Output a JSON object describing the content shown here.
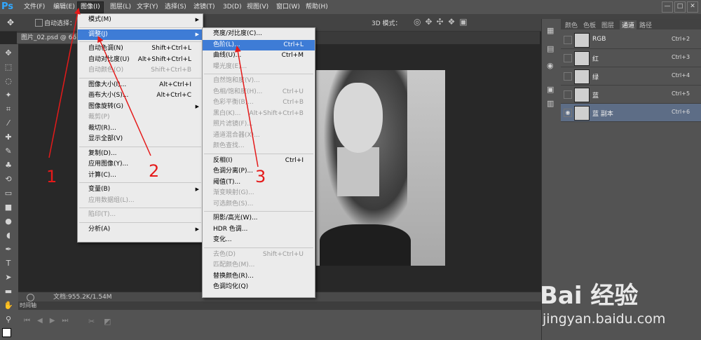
{
  "app": {
    "logo": "Ps"
  },
  "menubar": {
    "items": [
      "文件(F)",
      "编辑(E)",
      "图像(I)",
      "图层(L)",
      "文字(Y)",
      "选择(S)",
      "滤镜(T)",
      "3D(D)",
      "视图(V)",
      "窗口(W)",
      "帮助(H)"
    ],
    "active_index": 2
  },
  "window_buttons": [
    "—",
    "□",
    "✕"
  ],
  "optbar": {
    "auto_select_label": "自动选择：",
    "mode3d_label": "3D 模式："
  },
  "doc_tab": {
    "label": "图片_02.psd @ 66.7"
  },
  "status": {
    "doc_text": "文档:955.2K/1.54M"
  },
  "timeline": {
    "label": "时间轴"
  },
  "image_menu": {
    "items": [
      {
        "label": "模式(M)",
        "shortcut": "",
        "submenu": true,
        "disabled": false
      },
      {
        "sep": true
      },
      {
        "label": "调整(J)",
        "shortcut": "",
        "submenu": true,
        "disabled": false,
        "highlighted": true
      },
      {
        "sep": true
      },
      {
        "label": "自动色调(N)",
        "shortcut": "Shift+Ctrl+L",
        "disabled": false
      },
      {
        "label": "自动对比度(U)",
        "shortcut": "Alt+Shift+Ctrl+L",
        "disabled": false
      },
      {
        "label": "自动颜色(O)",
        "shortcut": "Shift+Ctrl+B",
        "disabled": true
      },
      {
        "sep": true
      },
      {
        "label": "图像大小(I)...",
        "shortcut": "Alt+Ctrl+I",
        "disabled": false
      },
      {
        "label": "画布大小(S)...",
        "shortcut": "Alt+Ctrl+C",
        "disabled": false
      },
      {
        "label": "图像旋转(G)",
        "shortcut": "",
        "submenu": true,
        "disabled": false
      },
      {
        "label": "裁剪(P)",
        "shortcut": "",
        "disabled": true
      },
      {
        "label": "裁切(R)...",
        "shortcut": "",
        "disabled": false
      },
      {
        "label": "显示全部(V)",
        "shortcut": "",
        "disabled": false
      },
      {
        "sep": true
      },
      {
        "label": "复制(D)...",
        "shortcut": "",
        "disabled": false
      },
      {
        "label": "应用图像(Y)...",
        "shortcut": "",
        "disabled": false
      },
      {
        "label": "计算(C)...",
        "shortcut": "",
        "disabled": false
      },
      {
        "sep": true
      },
      {
        "label": "变量(B)",
        "shortcut": "",
        "submenu": true,
        "disabled": false
      },
      {
        "label": "应用数据组(L)...",
        "shortcut": "",
        "disabled": true
      },
      {
        "sep": true
      },
      {
        "label": "陷印(T)...",
        "shortcut": "",
        "disabled": true
      },
      {
        "sep": true
      },
      {
        "label": "分析(A)",
        "shortcut": "",
        "submenu": true,
        "disabled": false
      }
    ]
  },
  "adjust_menu": {
    "items": [
      {
        "label": "亮度/对比度(C)...",
        "shortcut": "",
        "disabled": false
      },
      {
        "label": "色阶(L)...",
        "shortcut": "Ctrl+L",
        "disabled": false,
        "highlighted": true
      },
      {
        "label": "曲线(U)...",
        "shortcut": "Ctrl+M",
        "disabled": false
      },
      {
        "label": "曝光度(E)...",
        "shortcut": "",
        "disabled": true
      },
      {
        "sep": true
      },
      {
        "label": "自然饱和度(V)...",
        "shortcut": "",
        "disabled": true
      },
      {
        "label": "色相/饱和度(H)...",
        "shortcut": "Ctrl+U",
        "disabled": true
      },
      {
        "label": "色彩平衡(B)...",
        "shortcut": "Ctrl+B",
        "disabled": true
      },
      {
        "label": "黑白(K)...",
        "shortcut": "Alt+Shift+Ctrl+B",
        "disabled": true
      },
      {
        "label": "照片滤镜(F)...",
        "shortcut": "",
        "disabled": true
      },
      {
        "label": "通道混合器(X)...",
        "shortcut": "",
        "disabled": true
      },
      {
        "label": "颜色查找...",
        "shortcut": "",
        "disabled": true
      },
      {
        "sep": true
      },
      {
        "label": "反相(I)",
        "shortcut": "Ctrl+I",
        "disabled": false
      },
      {
        "label": "色调分离(P)...",
        "shortcut": "",
        "disabled": false
      },
      {
        "label": "阈值(T)...",
        "shortcut": "",
        "disabled": false
      },
      {
        "label": "渐变映射(G)...",
        "shortcut": "",
        "disabled": true
      },
      {
        "label": "可选颜色(S)...",
        "shortcut": "",
        "disabled": true
      },
      {
        "sep": true
      },
      {
        "label": "阴影/高光(W)...",
        "shortcut": "",
        "disabled": false
      },
      {
        "label": "HDR 色调...",
        "shortcut": "",
        "disabled": false
      },
      {
        "label": "变化...",
        "shortcut": "",
        "disabled": false
      },
      {
        "sep": true
      },
      {
        "label": "去色(D)",
        "shortcut": "Shift+Ctrl+U",
        "disabled": true
      },
      {
        "label": "匹配颜色(M)...",
        "shortcut": "",
        "disabled": true
      },
      {
        "label": "替换颜色(R)...",
        "shortcut": "",
        "disabled": false
      },
      {
        "label": "色调均化(Q)",
        "shortcut": "",
        "disabled": false
      }
    ]
  },
  "panel": {
    "tabs": [
      "颜色",
      "色板",
      "图层",
      "通道",
      "路径"
    ],
    "active_tab": 3,
    "channels": [
      {
        "name": "RGB",
        "shortcut": "Ctrl+2",
        "selected": false
      },
      {
        "name": "红",
        "shortcut": "Ctrl+3",
        "selected": false
      },
      {
        "name": "绿",
        "shortcut": "Ctrl+4",
        "selected": false
      },
      {
        "name": "蓝",
        "shortcut": "Ctrl+5",
        "selected": false
      },
      {
        "name": "蓝 副本",
        "shortcut": "Ctrl+6",
        "selected": true
      }
    ]
  },
  "annotations": {
    "steps": [
      "1",
      "2",
      "3"
    ],
    "color": "#e51a1a"
  },
  "watermark": {
    "logo": "Bai 经验",
    "url": "jingyan.baidu.com"
  },
  "colors": {
    "highlight": "#3e7cd6",
    "accent": "#31a8ff"
  }
}
